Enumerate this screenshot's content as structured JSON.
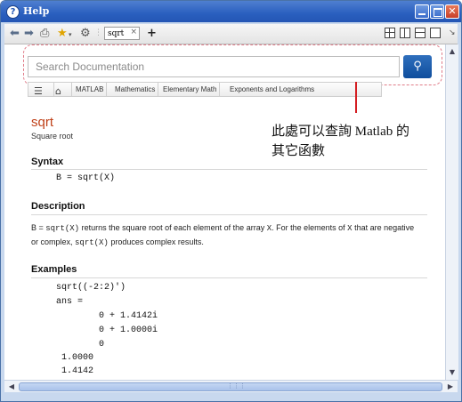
{
  "window": {
    "title": "Help"
  },
  "toolbar": {
    "icons": [
      "back-icon",
      "forward-icon",
      "print-icon",
      "favorites-icon",
      "settings-icon"
    ],
    "tab_label": "sqrt",
    "tab_close": "×",
    "add_tab": "+"
  },
  "search": {
    "placeholder": "Search Documentation"
  },
  "breadcrumb": {
    "items": [
      "MATLAB",
      "Mathematics",
      "Elementary Math",
      "Exponents and Logarithms"
    ]
  },
  "annotation": {
    "line1": "此處可以查詢 Matlab 的",
    "line2": "其它函數"
  },
  "page": {
    "function_name": "sqrt",
    "function_desc": "Square root",
    "syntax_heading": "Syntax",
    "syntax_code": "B = sqrt(X)",
    "description_heading": "Description",
    "description": {
      "p1": "B = ",
      "c1": "sqrt(X)",
      "p2": " returns the square root of each element of the array ",
      "c2": "X",
      "p3": ". For the elements of ",
      "c3": "X",
      "p4": " that are negative or complex, ",
      "c4": "sqrt(X)",
      "p5": " produces complex results."
    },
    "examples_heading": "Examples",
    "example_lines": [
      "sqrt((-2:2)')",
      "ans =",
      "        0 + 1.4142i",
      "        0 + 1.0000i",
      "        0",
      " 1.0000",
      " 1.4142"
    ]
  },
  "colors": {
    "accent": "#c0421a",
    "search_button": "#1a5aa8",
    "annotation_line": "#d41e22"
  }
}
